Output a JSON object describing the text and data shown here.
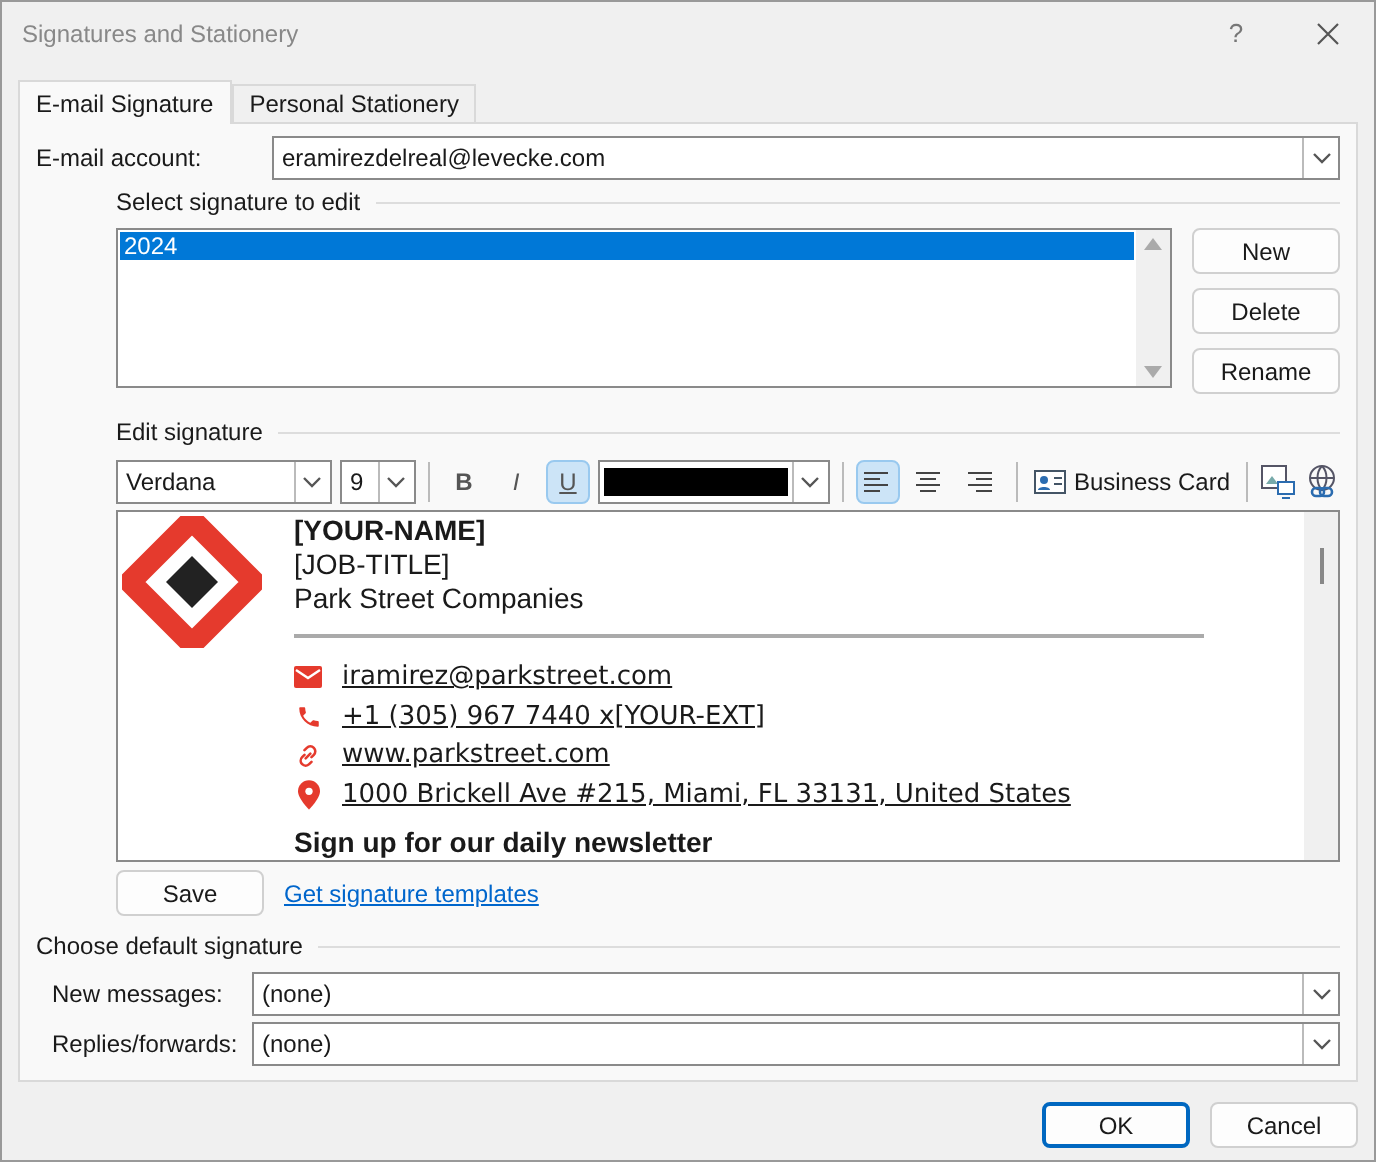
{
  "window": {
    "title": "Signatures and Stationery",
    "help": "?"
  },
  "tabs": [
    {
      "label": "E-mail Signature",
      "selected": true
    },
    {
      "label": "Personal Stationery",
      "selected": false
    }
  ],
  "account": {
    "label": "E-mail account:",
    "value": "eramirezdelreal@levecke.com"
  },
  "select_section": {
    "title": "Select signature to edit",
    "items": [
      {
        "label": "2024",
        "selected": true
      }
    ],
    "buttons": [
      "New",
      "Delete",
      "Rename"
    ]
  },
  "edit_section": {
    "title": "Edit signature",
    "font": "Verdana",
    "size": "9",
    "format": [
      {
        "kind": "bold",
        "label": "B",
        "selected": false
      },
      {
        "kind": "italic",
        "label": "I",
        "selected": false
      },
      {
        "kind": "underline",
        "label": "U",
        "selected": true
      }
    ],
    "color": "#000000",
    "align": [
      {
        "kind": "left",
        "selected": true
      },
      {
        "kind": "center",
        "selected": false
      },
      {
        "kind": "right",
        "selected": false
      }
    ],
    "business_card": "Business Card"
  },
  "signature": {
    "name": "[YOUR-NAME]",
    "job_title": "[JOB-TITLE]",
    "company": "Park Street Companies",
    "contacts": [
      {
        "kind": "email",
        "text": "iramirez@parkstreet.com"
      },
      {
        "kind": "phone",
        "text": "+1 (305) 967 7440 x[YOUR-EXT]"
      },
      {
        "kind": "link",
        "text": "www.parkstreet.com"
      },
      {
        "kind": "location",
        "text": "1000 Brickell Ave #215, Miami, FL 33131, United States"
      }
    ],
    "newsletter": "Sign up for our daily newsletter"
  },
  "save": "Save",
  "templates_link": "Get signature templates",
  "defaults": {
    "title": "Choose default signature",
    "rows": [
      {
        "label": "New messages:",
        "value": "(none)"
      },
      {
        "label": "Replies/forwards:",
        "value": "(none)"
      }
    ]
  },
  "footer_buttons": [
    {
      "label": "OK",
      "default": true
    },
    {
      "label": "Cancel",
      "default": false
    }
  ]
}
